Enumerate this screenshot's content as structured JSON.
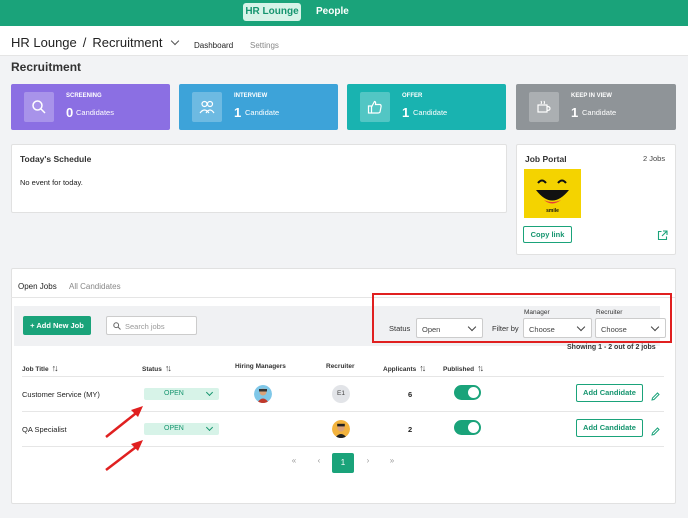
{
  "colors": {
    "brand": "#1aa37a",
    "screening": "#8b6fe3",
    "interview": "#3da3d9",
    "offer": "#19b3b0",
    "keep_in_view": "#8f9498",
    "annotation_red": "#e02020"
  },
  "topnav": {
    "hr_lounge": "HR Lounge",
    "people": "People"
  },
  "header": {
    "crumb_root": "HR Lounge",
    "crumb_sep": "/",
    "crumb_current": "Recruitment",
    "tab_dashboard": "Dashboard",
    "tab_settings": "Settings"
  },
  "page_title": "Recruitment",
  "stats": [
    {
      "label": "SCREENING",
      "count": "0",
      "unit": "Candidates",
      "icon": "search-icon"
    },
    {
      "label": "INTERVIEW",
      "count": "1",
      "unit": "Candidate",
      "icon": "people-icon"
    },
    {
      "label": "OFFER",
      "count": "1",
      "unit": "Candidate",
      "icon": "thumbs-up-icon"
    },
    {
      "label": "KEEP IN VIEW",
      "count": "1",
      "unit": "Candidate",
      "icon": "coffee-cup-icon"
    }
  ],
  "schedule": {
    "title": "Today's Schedule",
    "empty": "No event for today."
  },
  "job_portal": {
    "title": "Job Portal",
    "count": "2 Jobs",
    "logo_text": "smile",
    "copy_link": "Copy link"
  },
  "tabs": {
    "open_jobs": "Open Jobs",
    "all_candidates": "All Candidates"
  },
  "toolbar": {
    "add_job": "+ Add New Job",
    "search_placeholder": "Search jobs",
    "status_label": "Status",
    "status_value": "Open",
    "filter_by": "Filter by",
    "manager_label": "Manager",
    "manager_value": "Choose",
    "recruiter_label": "Recruiter",
    "recruiter_value": "Choose"
  },
  "showing": "Showing 1 - 2 out of 2 jobs",
  "table": {
    "headers": {
      "job_title": "Job Title",
      "status": "Status",
      "hiring_managers": "Hiring Managers",
      "recruiter": "Recruiter",
      "applicants": "Applicants",
      "published": "Published"
    },
    "rows": [
      {
        "title": "Customer Service (MY)",
        "status": "OPEN",
        "recruiter": "E1",
        "applicants": "6",
        "published": true,
        "action": "Add Candidate"
      },
      {
        "title": "QA Specialist",
        "status": "OPEN",
        "recruiter": "",
        "applicants": "2",
        "published": true,
        "action": "Add Candidate"
      }
    ]
  },
  "pagination": {
    "first": "«",
    "prev": "‹",
    "current": "1",
    "next": "›",
    "last": "»"
  }
}
